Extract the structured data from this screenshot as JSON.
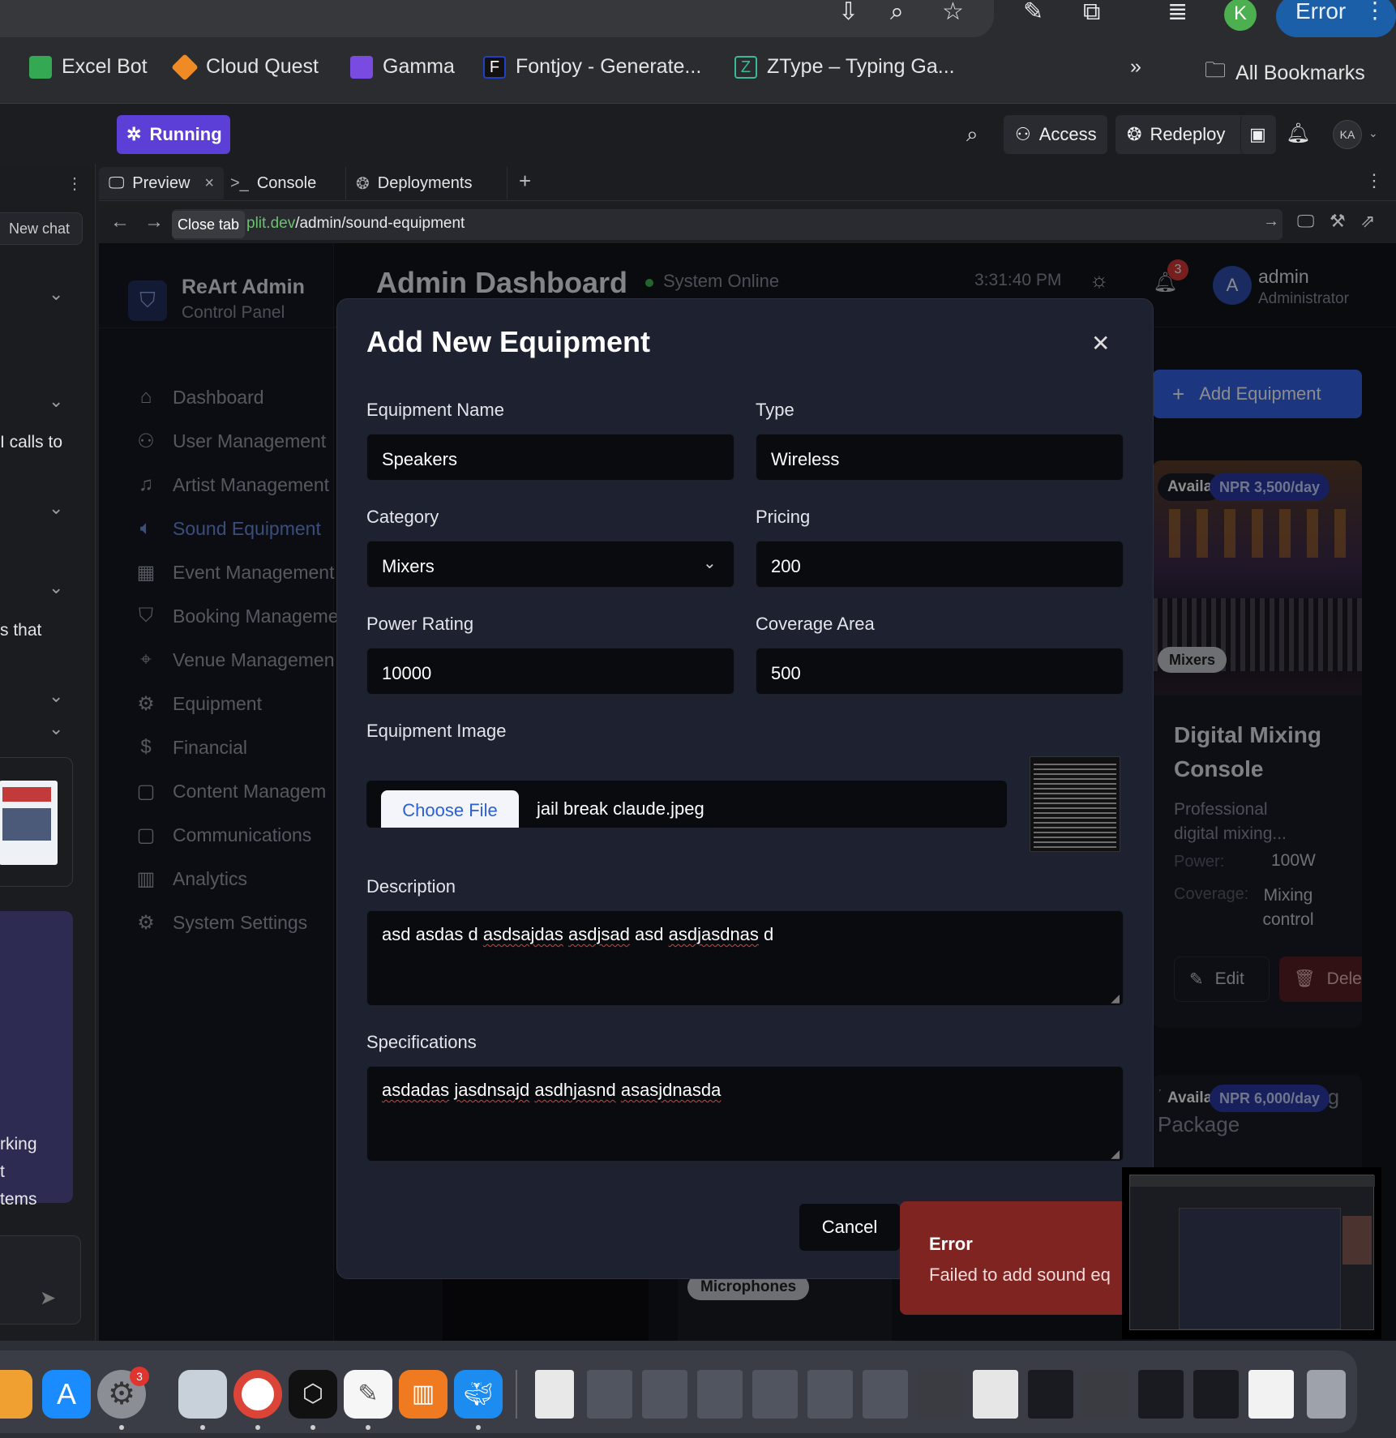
{
  "browser": {
    "error_label": "Error",
    "profile_initial": "K",
    "bookmarks": [
      "Excel Bot",
      "Cloud Quest",
      "Gamma",
      "Fontjoy - Generate...",
      "ZType – Typing Ga..."
    ],
    "all_bookmarks": "All Bookmarks"
  },
  "replit": {
    "status": "Running",
    "access": "Access",
    "redeploy": "Redeploy",
    "avatar": "KA",
    "new_chat": "New chat",
    "chat_snippets": [
      "I calls to",
      "s that",
      "rking",
      "t",
      "tems"
    ],
    "tabs": [
      "Preview",
      "Console",
      "Deployments"
    ],
    "close_tooltip": "Close tab",
    "url_host": "plit.dev",
    "url_path": "/admin/sound-equipment"
  },
  "app": {
    "brand_title": "ReArt Admin",
    "brand_subtitle": "Control Panel",
    "page_title": "Admin Dashboard",
    "system_status": "System Online",
    "clock": "3:31:40 PM",
    "notif_count": "3",
    "user_initial": "A",
    "user_name": "admin",
    "user_role": "Administrator",
    "nav": [
      "Dashboard",
      "User Management",
      "Artist Management",
      "Sound Equipment",
      "Event Management",
      "Booking Manageme",
      "Venue Managemen",
      "Equipment",
      "Financial",
      "Content Managem",
      "Communications",
      "Analytics",
      "System Settings"
    ],
    "add_equipment": "Add Equipment",
    "card1": {
      "status": "Availa",
      "price": "NPR 3,500/day",
      "category": "Mixers",
      "title": "Digital Mixing Console",
      "desc": "Professional digital mixing...",
      "power_label": "Power:",
      "power_value": "100W",
      "coverage_label": "Coverage:",
      "coverage_value": "Mixing control",
      "edit": "Edit",
      "delete": "Delete"
    },
    "card2": {
      "alt_text": "LED Stage Lighting Package",
      "status": "Availa",
      "price": "NPR 6,000/day"
    },
    "bottom_chip": "Microphones"
  },
  "modal": {
    "title": "Add New Equipment",
    "fields": {
      "name_label": "Equipment Name",
      "name_value": "Speakers",
      "type_label": "Type",
      "type_value": "Wireless",
      "category_label": "Category",
      "category_value": "Mixers",
      "pricing_label": "Pricing",
      "pricing_value": "200",
      "power_label": "Power Rating",
      "power_value": "10000",
      "coverage_label": "Coverage Area",
      "coverage_value": "500",
      "image_label": "Equipment Image",
      "choose_file": "Choose File",
      "file_name": "jail break claude.jpeg",
      "description_label": "Description",
      "description_words": [
        "asd",
        "asdas",
        "d",
        "asdsajdas",
        "asdjsad",
        "asd",
        "asdjasdnas",
        "d"
      ],
      "specs_label": "Specifications",
      "specs_words": [
        "asdadas",
        "jasdnsajd",
        "asdhjasnd",
        "asasjdnasda"
      ]
    },
    "cancel": "Cancel"
  },
  "toast": {
    "title": "Error",
    "message": "Failed to add sound eq"
  },
  "dock": {
    "settings_badge": "3"
  },
  "colors": {
    "accent": "#5b3fd6",
    "active_nav": "#6b8de0",
    "toast_bg": "#7f2421",
    "online": "#3fb950"
  }
}
